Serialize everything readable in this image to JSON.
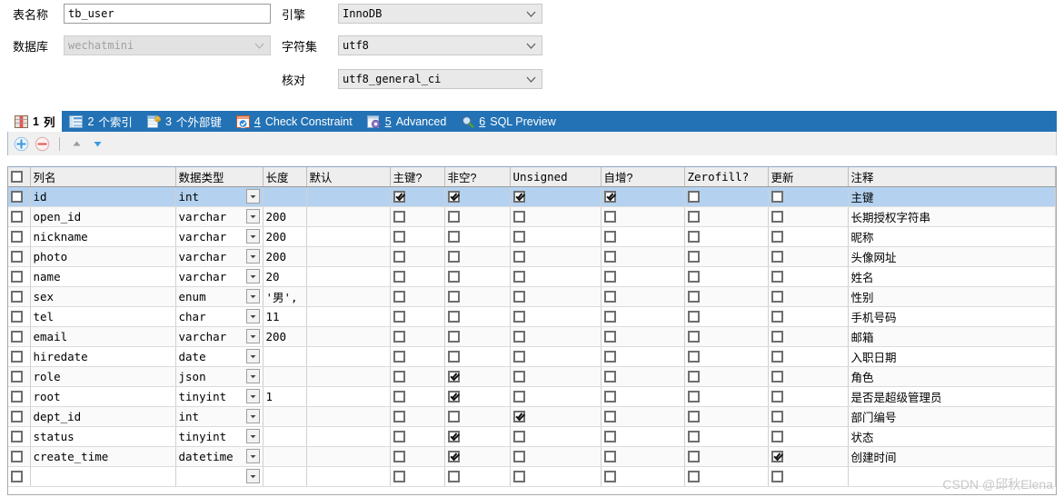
{
  "form": {
    "table_name_label": "表名称",
    "table_name_value": "tb_user",
    "database_label": "数据库",
    "database_value": "wechatmini",
    "engine_label": "引擎",
    "engine_value": "InnoDB",
    "charset_label": "字符集",
    "charset_value": "utf8",
    "collation_label": "核对",
    "collation_value": "utf8_general_ci"
  },
  "tabs": [
    {
      "accel": "1",
      "label": "列",
      "icon": "columns-icon",
      "active": true,
      "cjk": true
    },
    {
      "accel": "2",
      "label": "个索引",
      "icon": "index-icon",
      "active": false,
      "cjk": true
    },
    {
      "accel": "3",
      "label": "个外部键",
      "icon": "foreign-key-icon",
      "active": false,
      "cjk": true
    },
    {
      "accel": "4",
      "label": "Check Constraint",
      "icon": "check-constraint-icon",
      "active": false,
      "cjk": false
    },
    {
      "accel": "5",
      "label": "Advanced",
      "icon": "advanced-gear-icon",
      "active": false,
      "cjk": false
    },
    {
      "accel": "6",
      "label": "SQL Preview",
      "icon": "sql-preview-magnifier-icon",
      "active": false,
      "cjk": false
    }
  ],
  "toolbar": {
    "add_label": "添加字段",
    "remove_label": "删除字段",
    "move_up_label": "上移",
    "move_down_label": "下移"
  },
  "grid": {
    "headers": [
      "",
      "列名",
      "数据类型",
      "长度",
      "默认",
      "主键?",
      "非空?",
      "Unsigned",
      "自增?",
      "Zerofill?",
      "更新",
      "注释"
    ],
    "rows": [
      {
        "sel": true,
        "name": "id",
        "type": "int",
        "len": "",
        "def": "",
        "pk": true,
        "nn": true,
        "uns": true,
        "ai": true,
        "zf": false,
        "upd": false,
        "comment": "主键"
      },
      {
        "sel": false,
        "name": "open_id",
        "type": "varchar",
        "len": "200",
        "def": "",
        "pk": false,
        "nn": false,
        "uns": false,
        "ai": false,
        "zf": false,
        "upd": false,
        "comment": "长期授权字符串"
      },
      {
        "sel": false,
        "name": "nickname",
        "type": "varchar",
        "len": "200",
        "def": "",
        "pk": false,
        "nn": false,
        "uns": false,
        "ai": false,
        "zf": false,
        "upd": false,
        "comment": "昵称"
      },
      {
        "sel": false,
        "name": "photo",
        "type": "varchar",
        "len": "200",
        "def": "",
        "pk": false,
        "nn": false,
        "uns": false,
        "ai": false,
        "zf": false,
        "upd": false,
        "comment": "头像网址"
      },
      {
        "sel": false,
        "name": "name",
        "type": "varchar",
        "len": "20",
        "def": "",
        "pk": false,
        "nn": false,
        "uns": false,
        "ai": false,
        "zf": false,
        "upd": false,
        "comment": "姓名"
      },
      {
        "sel": false,
        "name": "sex",
        "type": "enum",
        "len": "'男',",
        "def": "",
        "pk": false,
        "nn": false,
        "uns": false,
        "ai": false,
        "zf": false,
        "upd": false,
        "comment": "性别"
      },
      {
        "sel": false,
        "name": "tel",
        "type": "char",
        "len": "11",
        "def": "",
        "pk": false,
        "nn": false,
        "uns": false,
        "ai": false,
        "zf": false,
        "upd": false,
        "comment": "手机号码"
      },
      {
        "sel": false,
        "name": "email",
        "type": "varchar",
        "len": "200",
        "def": "",
        "pk": false,
        "nn": false,
        "uns": false,
        "ai": false,
        "zf": false,
        "upd": false,
        "comment": "邮箱"
      },
      {
        "sel": false,
        "name": "hiredate",
        "type": "date",
        "len": "",
        "def": "",
        "pk": false,
        "nn": false,
        "uns": false,
        "ai": false,
        "zf": false,
        "upd": false,
        "comment": "入职日期"
      },
      {
        "sel": false,
        "name": "role",
        "type": "json",
        "len": "",
        "def": "",
        "pk": false,
        "nn": true,
        "uns": false,
        "ai": false,
        "zf": false,
        "upd": false,
        "comment": "角色"
      },
      {
        "sel": false,
        "name": "root",
        "type": "tinyint",
        "len": "1",
        "def": "",
        "pk": false,
        "nn": true,
        "uns": false,
        "ai": false,
        "zf": false,
        "upd": false,
        "comment": "是否是超级管理员"
      },
      {
        "sel": false,
        "name": "dept_id",
        "type": "int",
        "len": "",
        "def": "",
        "pk": false,
        "nn": false,
        "uns": true,
        "ai": false,
        "zf": false,
        "upd": false,
        "comment": "部门编号"
      },
      {
        "sel": false,
        "name": "status",
        "type": "tinyint",
        "len": "",
        "def": "",
        "pk": false,
        "nn": true,
        "uns": false,
        "ai": false,
        "zf": false,
        "upd": false,
        "comment": "状态"
      },
      {
        "sel": false,
        "name": "create_time",
        "type": "datetime",
        "len": "",
        "def": "",
        "pk": false,
        "nn": true,
        "uns": false,
        "ai": false,
        "zf": false,
        "upd": true,
        "comment": "创建时间"
      },
      {
        "sel": false,
        "name": "",
        "type": "",
        "len": "",
        "def": "",
        "pk": false,
        "nn": false,
        "uns": false,
        "ai": false,
        "zf": false,
        "upd": false,
        "comment": ""
      }
    ]
  },
  "watermark": "CSDN @邱秋Elena",
  "colors": {
    "tab_bar": "#2372b5",
    "selected_row": "#b4d2f0",
    "header_bg": "#eeeeee"
  }
}
